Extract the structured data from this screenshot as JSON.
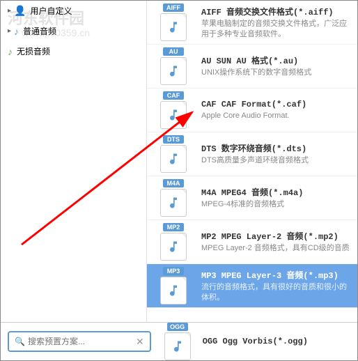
{
  "watermark": {
    "text": "河东软件园",
    "url": "www.pc0359.cn"
  },
  "sidebar": {
    "items": [
      {
        "label": "用户自定义",
        "icon": "user"
      },
      {
        "label": "普通音频",
        "icon": "note-blue"
      },
      {
        "label": "无损音频",
        "icon": "note-green"
      }
    ]
  },
  "formats": [
    {
      "badge": "AIFF",
      "title": "AIFF 音频交换文件格式(*.aiff)",
      "desc": "苹果电脑制定的音频交换文件格式，广泛应用于多种专业音频软件。"
    },
    {
      "badge": "AU",
      "title": "AU SUN AU 格式(*.au)",
      "desc": "UNIX操作系统下的数字音频格式"
    },
    {
      "badge": "CAF",
      "title": "CAF CAF Format(*.caf)",
      "desc": "Apple Core Audio Format."
    },
    {
      "badge": "DTS",
      "title": "DTS 数字环绕音频(*.dts)",
      "desc": "DTS高质量多声道环绕音频格式"
    },
    {
      "badge": "M4A",
      "title": "M4A MPEG4 音频(*.m4a)",
      "desc": "MPEG-4标准的音频格式"
    },
    {
      "badge": "MP2",
      "title": "MP2 MPEG Layer-2 音频(*.mp2)",
      "desc": "MPEG Layer-2 音频格式，具有CD级的音质"
    },
    {
      "badge": "MP3",
      "title": "MP3 MPEG Layer-3 音频(*.mp3)",
      "desc": "流行的音频格式，具有很好的音质和很小的体积。",
      "selected": true
    },
    {
      "badge": "OGG",
      "title": "OGG Ogg Vorbis(*.ogg)",
      "desc": ""
    }
  ],
  "search": {
    "placeholder": "搜索预置方案..."
  }
}
